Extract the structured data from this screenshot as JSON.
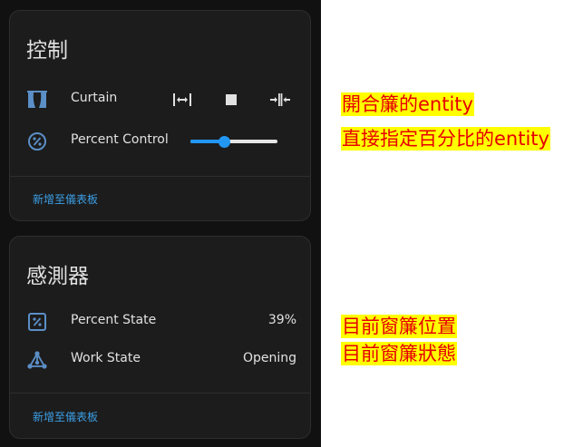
{
  "control_card": {
    "title": "控制",
    "curtain": {
      "label": "Curtain"
    },
    "percent_control": {
      "label": "Percent Control",
      "value_fraction": 0.39
    },
    "footer_link": "新增至儀表板"
  },
  "sensor_card": {
    "title": "感測器",
    "percent_state": {
      "label": "Percent State",
      "value": "39%"
    },
    "work_state": {
      "label": "Work State",
      "value": "Opening"
    },
    "footer_link": "新增至儀表板"
  },
  "annotations": {
    "line1": "開合簾的entity",
    "line2": "直接指定百分比的entity",
    "line3": "目前窗簾位置",
    "line4": "目前窗簾狀態"
  },
  "colors": {
    "accent": "#2196f3",
    "icon": "#5b8fc7",
    "note_text": "#e60000",
    "note_bg": "#ffff00"
  }
}
